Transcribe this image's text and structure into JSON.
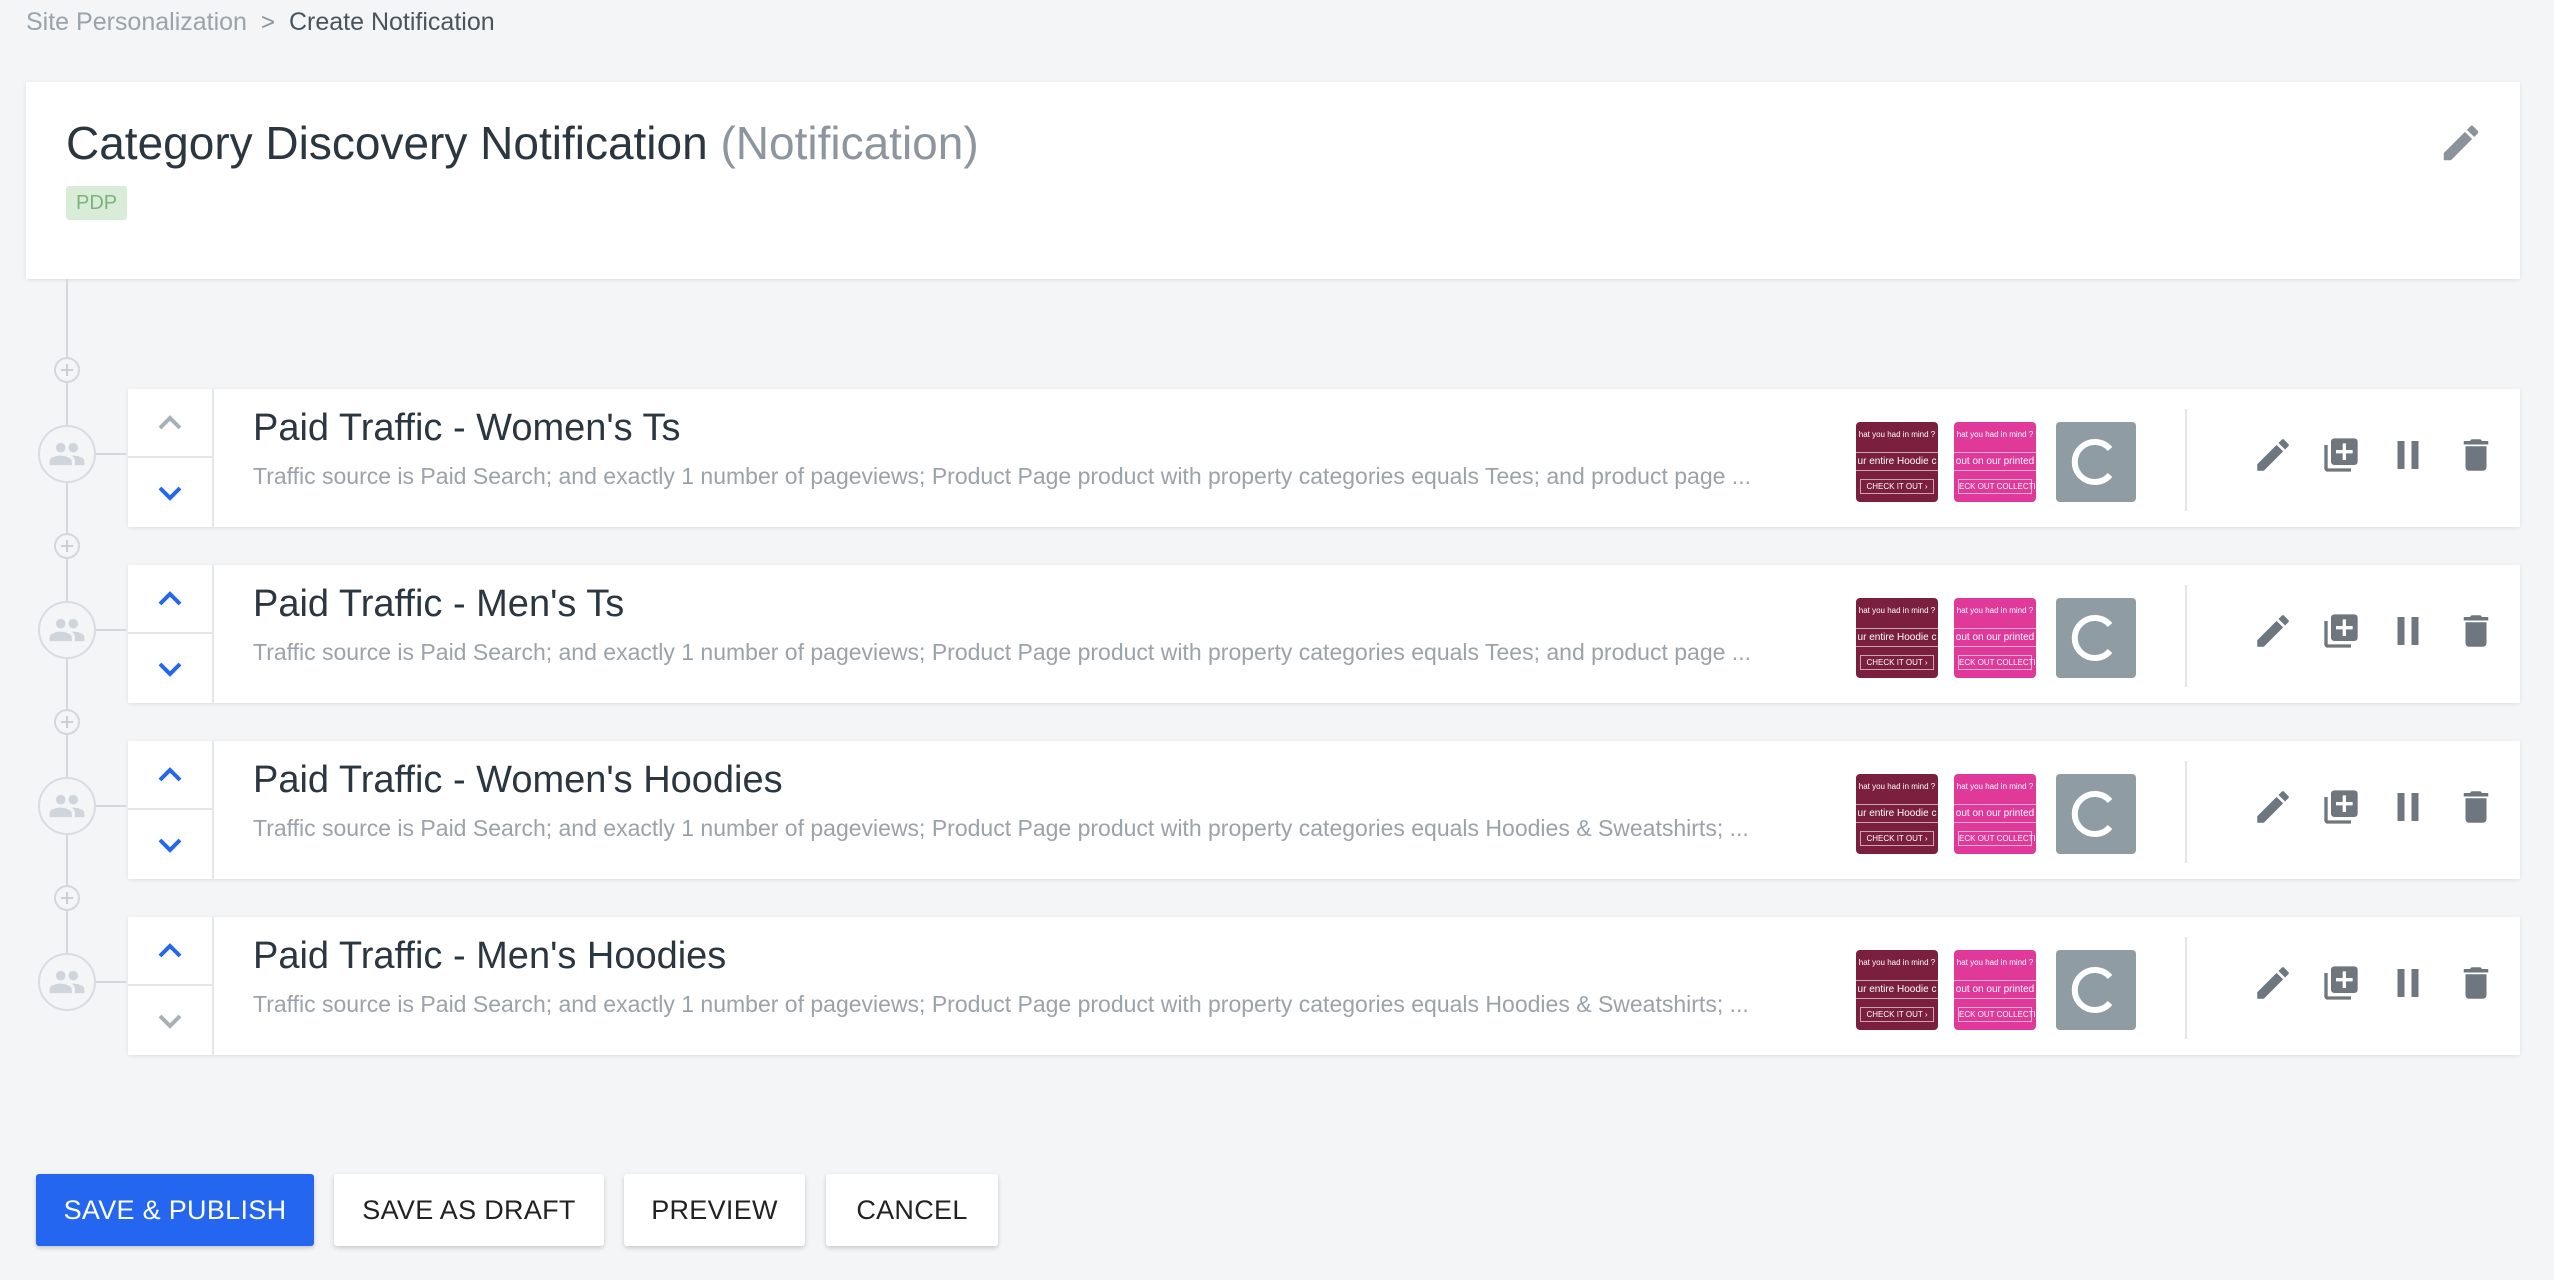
{
  "breadcrumb": {
    "parent": "Site Personalization",
    "separator": ">",
    "current": "Create Notification"
  },
  "header": {
    "title": "Category Discovery Notification",
    "type_label": "(Notification)",
    "tag": "PDP"
  },
  "thumbnails": {
    "maroon": {
      "line1": "hat you had in mind ?",
      "line2": "ur entire Hoodie c",
      "line3": "CHECK IT OUT ›"
    },
    "pink": {
      "line1": "hat you had in mind ?",
      "line2": "out on our printed",
      "line3": "ECK OUT COLLECTIO"
    },
    "c_label": "C"
  },
  "rules": [
    {
      "name": "Paid Traffic - Women's Ts",
      "description": "Traffic source is Paid Search; and exactly 1 number of pageviews; Product Page product with property categories equals Tees; and product page ..."
    },
    {
      "name": "Paid Traffic - Men's Ts",
      "description": "Traffic source is Paid Search; and exactly 1 number of pageviews; Product Page product with property categories equals Tees; and product page ..."
    },
    {
      "name": "Paid Traffic - Women's Hoodies",
      "description": "Traffic source is Paid Search; and exactly 1 number of pageviews; Product Page product with property categories equals Hoodies & Sweatshirts; ..."
    },
    {
      "name": "Paid Traffic - Men's Hoodies",
      "description": "Traffic source is Paid Search; and exactly 1 number of pageviews; Product Page product with property categories equals Hoodies & Sweatshirts; ..."
    }
  ],
  "buttons": {
    "publish": "SAVE & PUBLISH",
    "draft": "SAVE AS DRAFT",
    "preview": "PREVIEW",
    "cancel": "CANCEL"
  },
  "colors": {
    "primary": "#2466f0",
    "maroon_thumb": "#7a1f3d",
    "pink_thumb": "#e0399a",
    "tag_bg": "#d8ecd8",
    "tag_text": "#7cb37c"
  }
}
